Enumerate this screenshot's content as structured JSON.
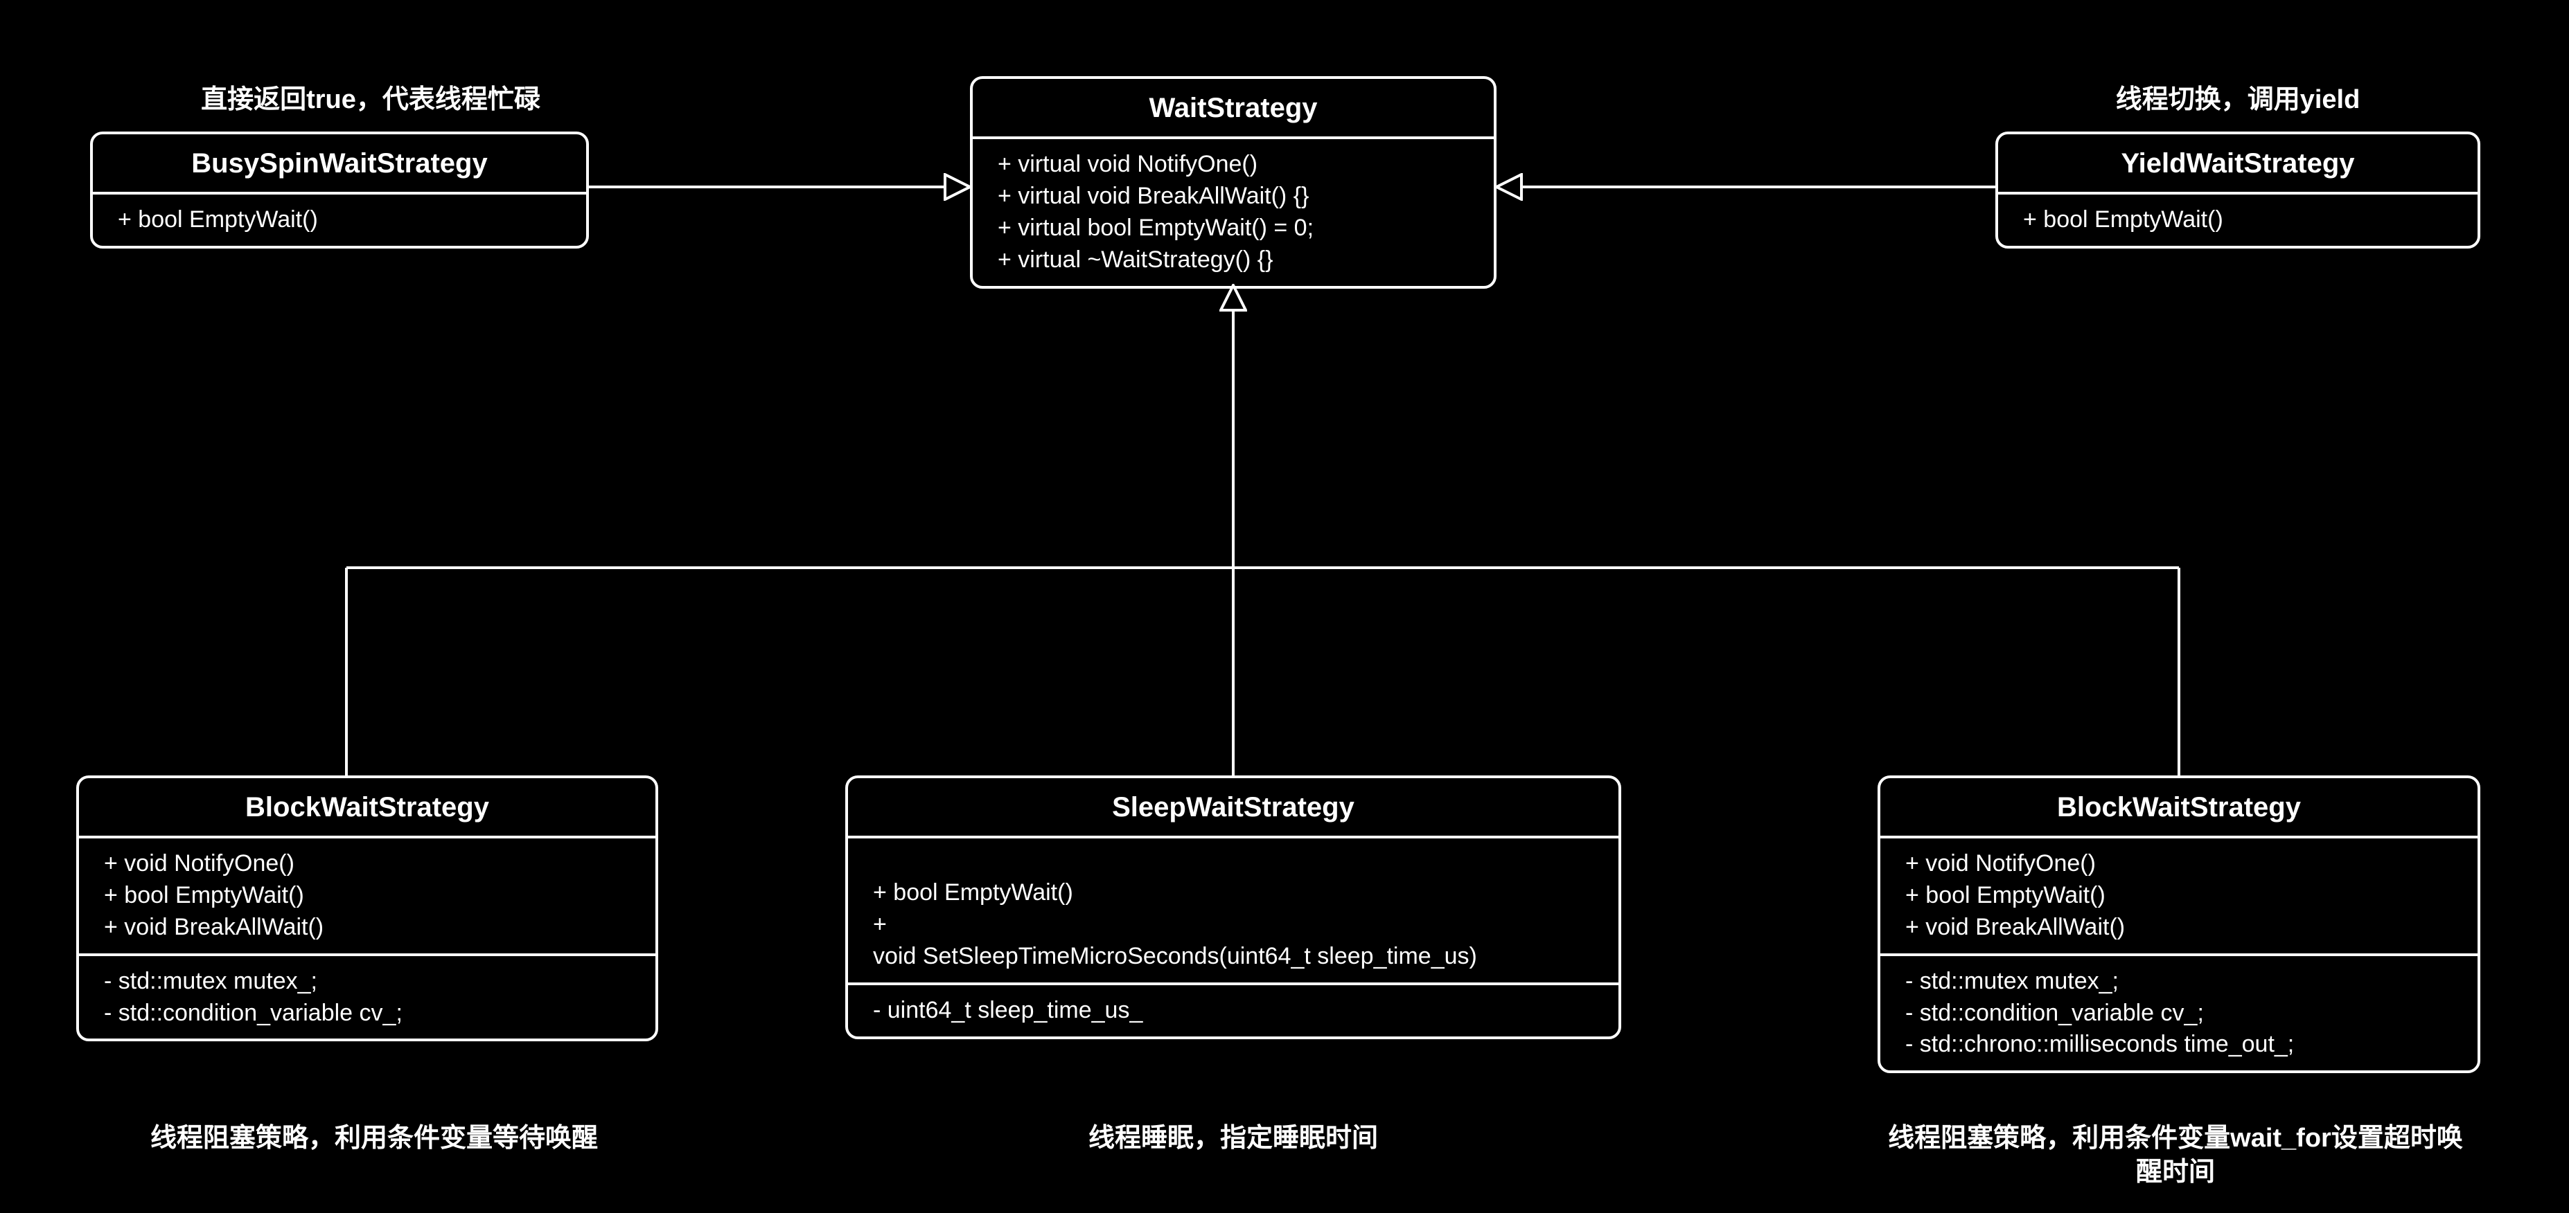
{
  "notes": {
    "busy_spin": "直接返回true，代表线程忙碌",
    "yield": "线程切换，调用yield",
    "block_left": "线程阻塞策略，利用条件变量等待唤醒",
    "sleep": "线程睡眠，指定睡眠时间",
    "block_right": "线程阻塞策略，利用条件变量wait_for设置超时唤醒时间"
  },
  "classes": {
    "wait_strategy": {
      "name": "WaitStrategy",
      "ops": [
        "+ virtual void NotifyOne()",
        "+ virtual void BreakAllWait() {}",
        "+ virtual bool EmptyWait() = 0;",
        "+ virtual ~WaitStrategy() {}"
      ]
    },
    "busy_spin": {
      "name": "BusySpinWaitStrategy",
      "ops": [
        "+ bool EmptyWait()"
      ]
    },
    "yield": {
      "name": "YieldWaitStrategy",
      "ops": [
        "+ bool EmptyWait()"
      ]
    },
    "block_left": {
      "name": "BlockWaitStrategy",
      "ops": [
        "+ void NotifyOne()",
        "+ bool EmptyWait()",
        "+ void BreakAllWait()"
      ],
      "attrs": [
        "- std::mutex mutex_;",
        "- std::condition_variable cv_;"
      ]
    },
    "sleep": {
      "name": "SleepWaitStrategy",
      "ops": [
        "+ bool EmptyWait()",
        "+",
        "void SetSleepTimeMicroSeconds(uint64_t sleep_time_us)"
      ],
      "attrs": [
        "- uint64_t sleep_time_us_"
      ]
    },
    "block_right": {
      "name": "BlockWaitStrategy",
      "ops": [
        "+ void NotifyOne()",
        "+ bool EmptyWait()",
        "+ void BreakAllWait()"
      ],
      "attrs": [
        "- std::mutex mutex_;",
        "- std::condition_variable cv_;",
        "- std::chrono::milliseconds time_out_;"
      ]
    }
  }
}
